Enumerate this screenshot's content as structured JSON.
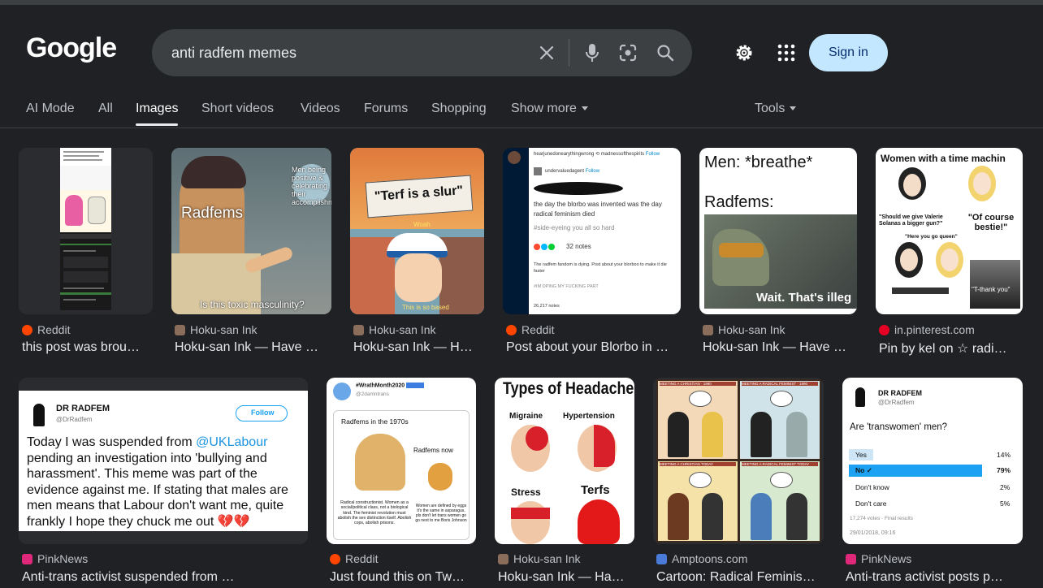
{
  "header": {
    "logo": "Google",
    "search_value": "anti radfem memes",
    "sign_in": "Sign in"
  },
  "icons": [
    "close-icon",
    "mic-icon",
    "lens-icon",
    "search-icon",
    "gear-icon",
    "apps-icon"
  ],
  "colors": {
    "background": "#202124",
    "search_bg": "#3c4043",
    "signin_bg": "#c2e7ff",
    "reddit": "#ff4500",
    "pinterest": "#e60023",
    "pinknews": "#e0287a"
  },
  "tabs": [
    "AI Mode",
    "All",
    "Images",
    "Short videos",
    "Videos",
    "Forums",
    "Shopping",
    "Show more",
    "Tools"
  ],
  "results": [
    {
      "source": "Reddit",
      "title": "this post was brou…"
    },
    {
      "source": "Hoku-san Ink",
      "title": "Hoku-san Ink — Have …"
    },
    {
      "source": "Hoku-san Ink",
      "title": "Hoku-san Ink — H…"
    },
    {
      "source": "Reddit",
      "title": "Post about your Blorbo in …"
    },
    {
      "source": "Hoku-san Ink",
      "title": "Hoku-san Ink — Have …"
    },
    {
      "source": "in.pinterest.com",
      "title": "Pin by kel on ☆ radi…"
    },
    {
      "source": "PinkNews",
      "title": "Anti-trans activist suspended from …"
    },
    {
      "source": "Reddit",
      "title": "Just found this on Tw…"
    },
    {
      "source": "Hoku-san Ink",
      "title": "Hoku-san Ink — Ha…"
    },
    {
      "source": "Amptoons.com",
      "title": "Cartoon: Radical Feminis…"
    },
    {
      "source": "PinkNews",
      "title": "Anti-trans activist posts p…"
    }
  ],
  "thumbs": {
    "t2_top": "Men being positive & celebrating their accomplishments",
    "t2_label": "Radfems",
    "t2_caption": "Is this toxic masculinity?",
    "t3_sign": "\"Terf is a slur\"",
    "t3_woah": "Woah",
    "t3_bottom": "This is so based",
    "t4_user1": "hearjunedonearythingwrong",
    "t4_user2": "madnessofthespirits",
    "t4_follow1": "Follow",
    "t4_user3": "undervaluedagent",
    "t4_follow2": "Follow",
    "t4_line1": "the day the blorbo was invented was the day",
    "t4_line2": "radical feminism died",
    "t4_tag": "#side-eyeing you all so hard",
    "t4_notes": "32 notes",
    "t4_text": "The radfem fandom is dying. Post about your blorboo to make it die faster",
    "t4_tag2": "#IM DPING MY FUCKING PART",
    "t4_notes2": "26,217 notes",
    "t5_top": "Men: *breathe*",
    "t5_mid": "Radfems:",
    "t5_caption": "Wait. That's illeg",
    "t6_title": "Women with a time machin",
    "t6_q": "\"Should we give Valerie Solanas a bigger gun?\"",
    "t6_a": "\"Of course bestie!\"",
    "t6_here": "\"Here you go queen\"",
    "t6_thanks": "\"T-thank you\"",
    "t7_name": "DR RADFEM",
    "t7_handle": "@DrRadfem",
    "t7_follow": "Follow",
    "t7_body": "Today I was suspended from",
    "t7_mention": "@UKLabour",
    "t7_body2": "pending an investigation into 'bullying and harassment'. This meme was part of the evidence against me. If stating that males are men means that Labour don't want me, quite frankly I hope they chuck me out 💔💔",
    "t8_user": "#WrathMonth2020",
    "t8_handle": "@2damntrans",
    "t8_top": "Radfems in the 1970s",
    "t8_now": "Radfems now",
    "t8_left": "Radical constructionist. Women as a social/political class, not a biological kind. The feminist revolution must abolish the sex distinction itself. Abolish cops, abolish prisons.",
    "t8_right": "Women are defined by eggs it's the same in asparagus, pls don't let trans women go go next to me Boris Johnson",
    "t9_title": "Types of Headaches",
    "t9_a": "Migraine",
    "t9_b": "Hypertension",
    "t9_c": "Stress",
    "t9_d": "Terfs",
    "t10_p1": "MEETING A CHRISTIAN · 1990",
    "t10_p2": "MEETING A RADICAL FEMINIST · 1990",
    "t10_p3": "MEETING A CHRISTIAN TODAY",
    "t10_p4": "MEETING A RADICAL FEMINIST TODAY",
    "t11_name": "DR RADFEM",
    "t11_handle": "@DrRadfem",
    "t11_q": "Are 'transwomen' men?",
    "t11_o1": "Yes",
    "t11_p1": "14%",
    "t11_o2": "No",
    "t11_p2": "79%",
    "t11_o3": "Don't know",
    "t11_p3": "2%",
    "t11_o4": "Don't care",
    "t11_p4": "5%",
    "t11_votes": "17,274 votes · Final results",
    "t11_date": "29/01/2018, 09:16"
  }
}
